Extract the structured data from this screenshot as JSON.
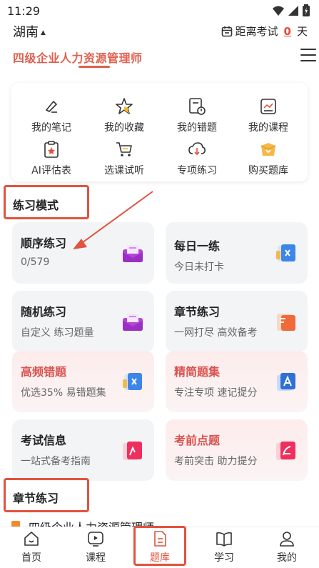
{
  "status_bar": {
    "time": "11:29"
  },
  "header": {
    "region": "湖南",
    "countdown_prefix": "距离考试",
    "countdown_days": "0",
    "countdown_suffix": "天"
  },
  "app_title": "四级企业人力资源管理师",
  "shortcuts": [
    {
      "label": "我的笔记",
      "icon": "note-pen-icon"
    },
    {
      "label": "我的收藏",
      "icon": "star-icon"
    },
    {
      "label": "我的错题",
      "icon": "wrong-questions-icon"
    },
    {
      "label": "我的课程",
      "icon": "course-icon"
    },
    {
      "label": "AI评估表",
      "icon": "clipboard-icon"
    },
    {
      "label": "选课试听",
      "icon": "cart-icon"
    },
    {
      "label": "专项练习",
      "icon": "download-cloud-icon"
    },
    {
      "label": "购买题库",
      "icon": "gift-box-icon"
    }
  ],
  "practice_section": {
    "title": "练习模式"
  },
  "modes": [
    {
      "title": "顺序练习",
      "subtitle": "0/579",
      "icon": "purple-envelope-icon",
      "style": "gray"
    },
    {
      "title": "每日一练",
      "subtitle": "今日未打卡",
      "icon": "blue-sheet-icon",
      "style": "gray"
    },
    {
      "title": "随机练习",
      "subtitle": "自定义 练习题量",
      "icon": "purple-envelope-icon",
      "style": "gray"
    },
    {
      "title": "章节练习",
      "subtitle": "一网打尽 高效备考",
      "icon": "orange-book-icon",
      "style": "gray"
    },
    {
      "title": "高频错题",
      "subtitle": "优选35% 易错题集",
      "icon": "blue-sheet-icon",
      "style": "pink"
    },
    {
      "title": "精简题集",
      "subtitle": "专注专项 速记提分",
      "icon": "blue-card-icon",
      "style": "pink"
    },
    {
      "title": "考试信息",
      "subtitle": "一站式备考指南",
      "icon": "pink-card-icon",
      "style": "gray"
    },
    {
      "title": "考前点题",
      "subtitle": "考前突击 助力提分",
      "icon": "pink-card-icon",
      "style": "pink"
    }
  ],
  "chapter_section": {
    "title": "章节练习"
  },
  "peek_text": "四级企业人力资源管理师",
  "tabs": [
    {
      "label": "首页",
      "icon": "home-icon"
    },
    {
      "label": "课程",
      "icon": "play-icon"
    },
    {
      "label": "题库",
      "icon": "question-bank-icon",
      "active": true
    },
    {
      "label": "学习",
      "icon": "book-icon"
    },
    {
      "label": "我的",
      "icon": "user-icon"
    }
  ],
  "colors": {
    "accent": "#e0533e",
    "title": "#e0604f",
    "pink_title": "#d9534f"
  }
}
